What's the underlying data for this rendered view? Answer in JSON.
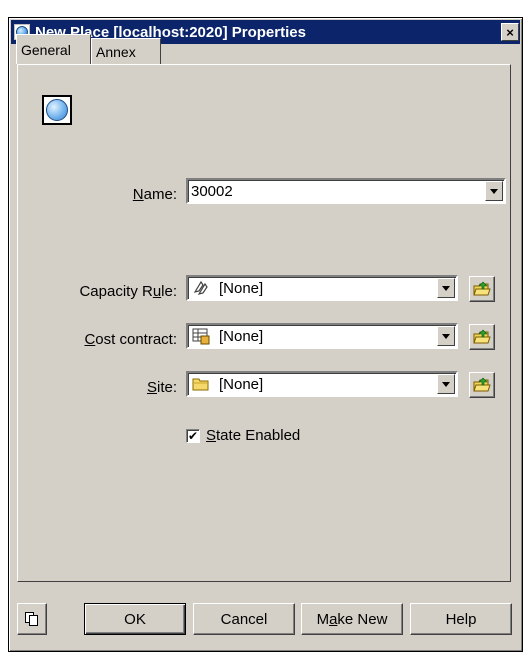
{
  "window": {
    "title": "New Place [localhost:2020] Properties",
    "close_glyph": "×"
  },
  "tabs": [
    {
      "label": "General",
      "active": true
    },
    {
      "label": "Annex",
      "active": false
    }
  ],
  "form": {
    "name": {
      "label_pre": "",
      "label_key": "N",
      "label_post": "ame:",
      "value": "30002"
    },
    "capacity_rule": {
      "label_pre": "Capacity R",
      "label_key": "u",
      "label_post": "le:",
      "value": "[None]",
      "icon": "capacity-rule-icon"
    },
    "cost_contract": {
      "label_pre": "",
      "label_key": "C",
      "label_post": "ost contract:",
      "value": "[None]",
      "icon": "cost-contract-icon"
    },
    "site": {
      "label_pre": "",
      "label_key": "S",
      "label_post": "ite:",
      "value": "[None]",
      "icon": "folder-icon"
    },
    "state_enabled": {
      "label_pre": "",
      "label_key": "S",
      "label_post": "tate Enabled",
      "checked": true,
      "check_glyph": "✔"
    }
  },
  "buttons": {
    "ok": "OK",
    "cancel": "Cancel",
    "make_new_pre": "M",
    "make_new_key": "a",
    "make_new_post": "ke New",
    "help": "Help"
  },
  "colors": {
    "title_bar": "#0b246a",
    "dialog_face": "#d4d0c8"
  }
}
